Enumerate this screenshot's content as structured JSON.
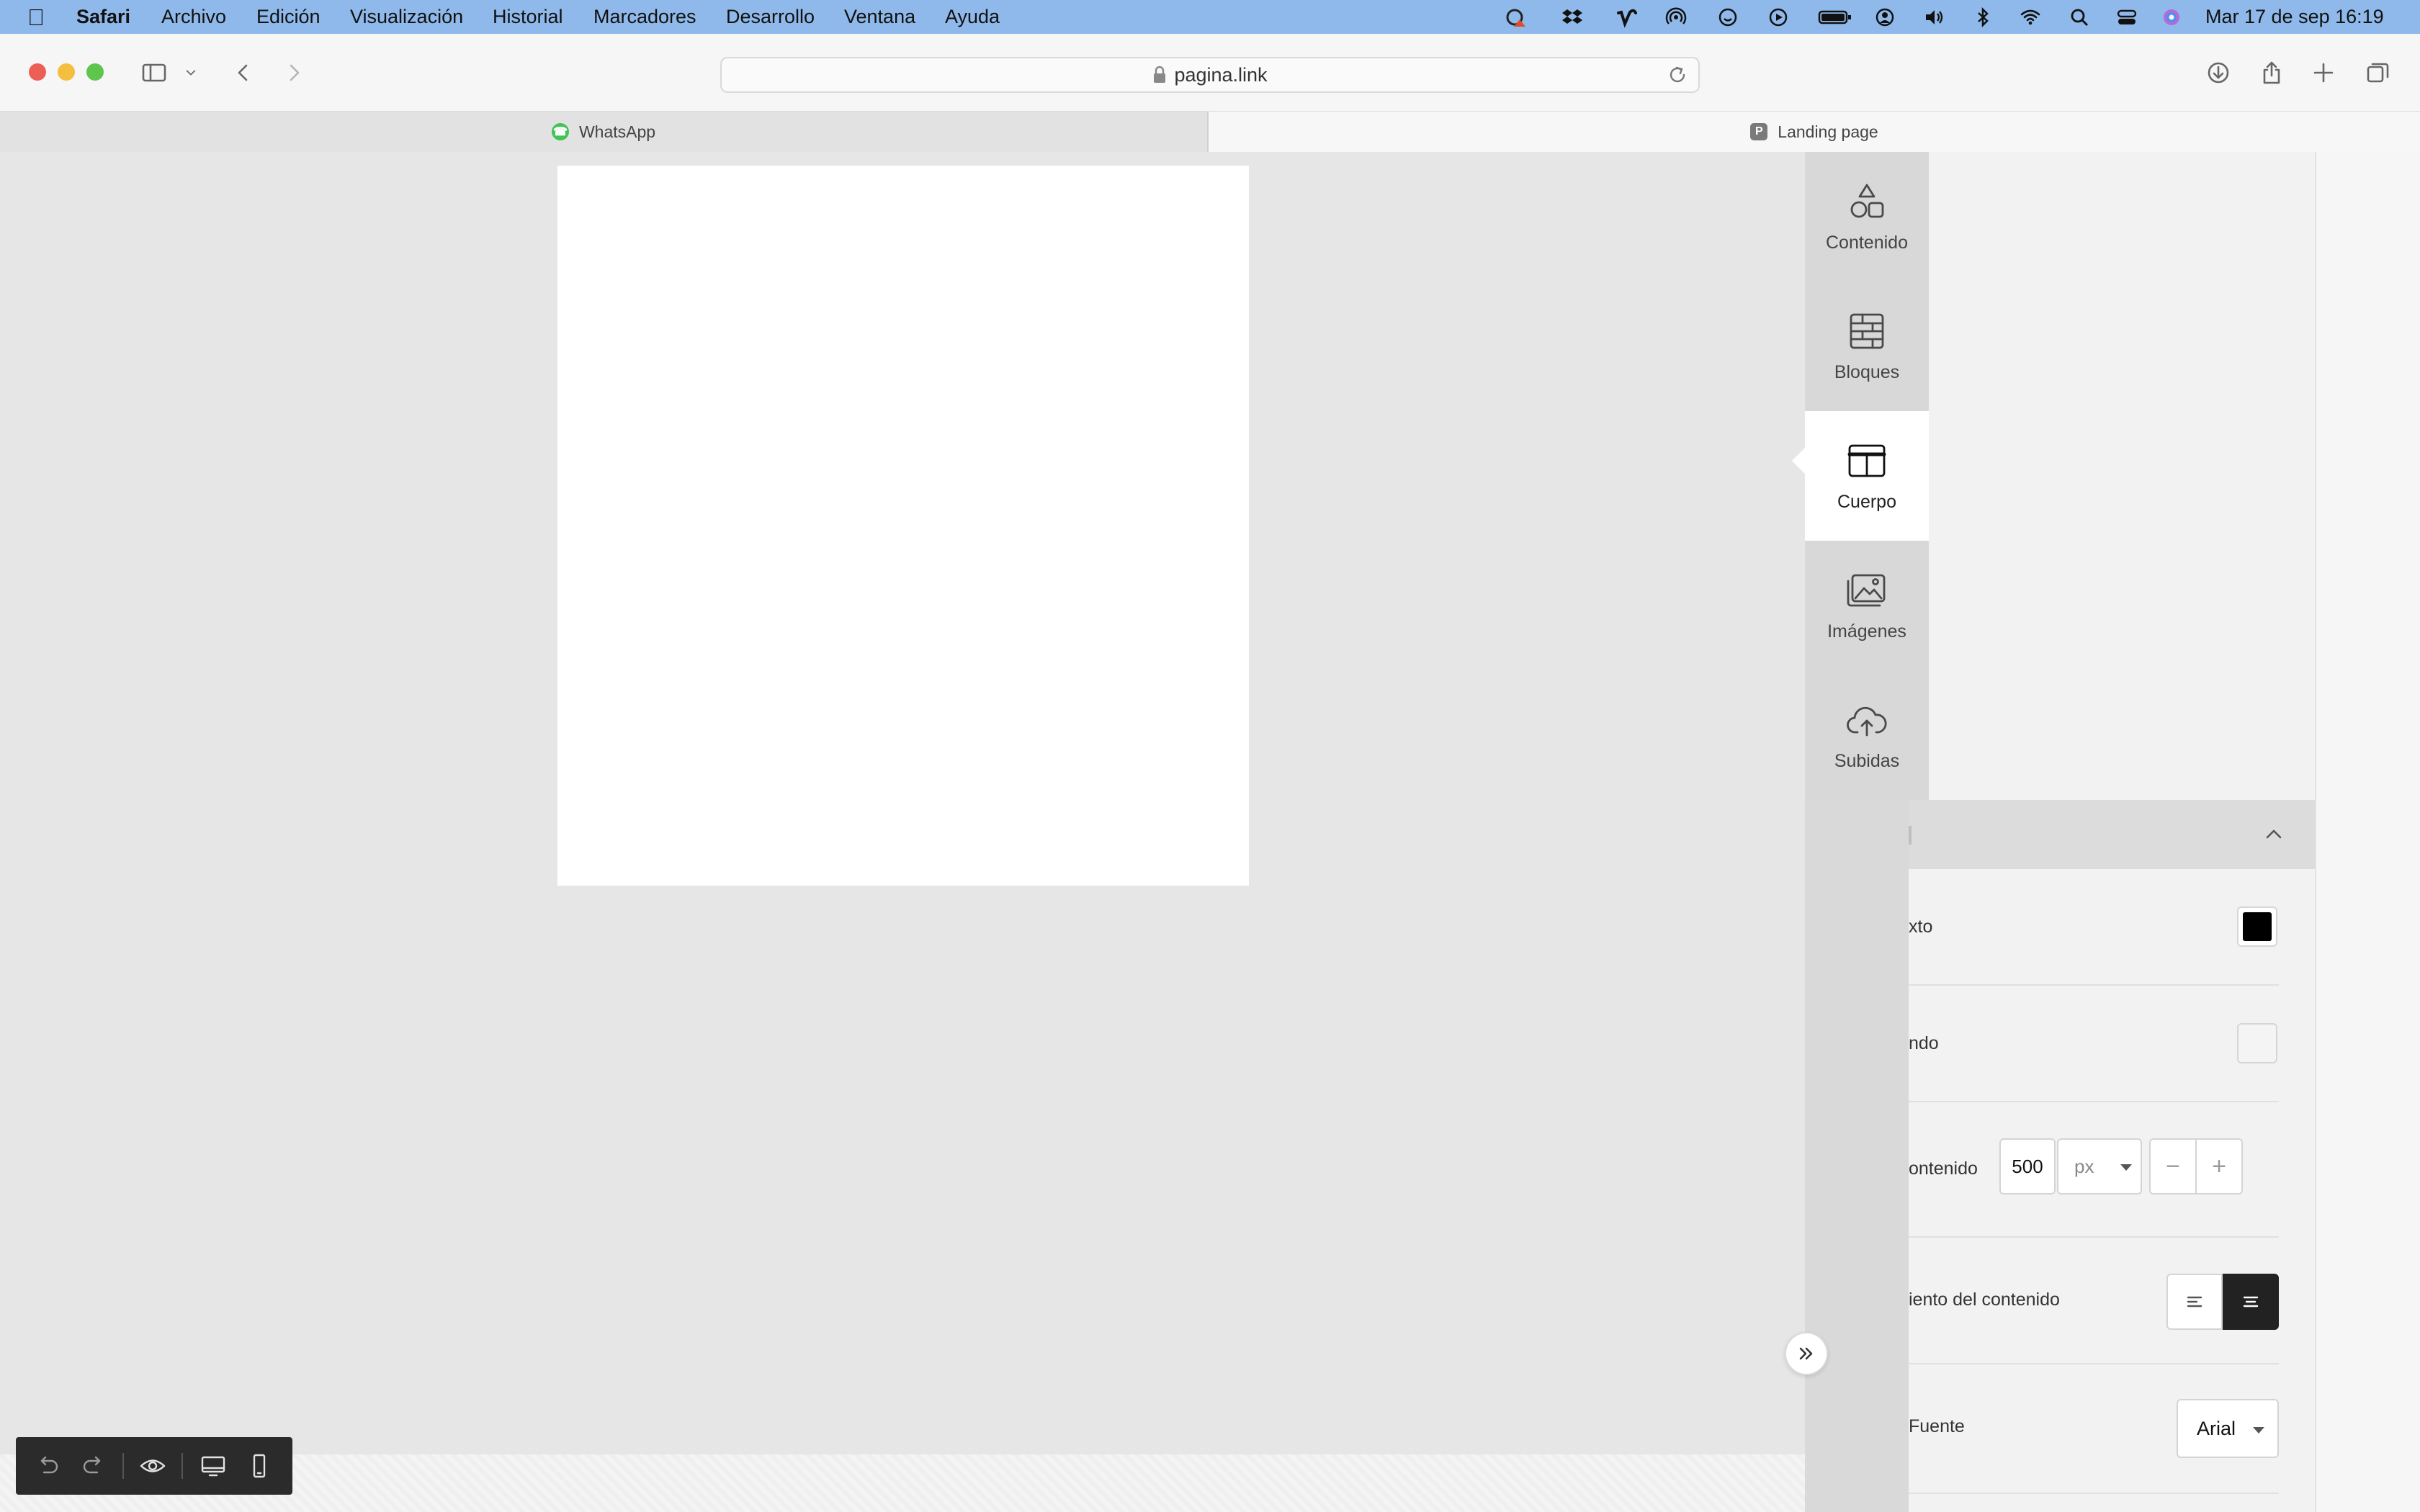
{
  "menubar": {
    "app": "Safari",
    "items": [
      "Archivo",
      "Edición",
      "Visualización",
      "Historial",
      "Marcadores",
      "Desarrollo",
      "Ventana",
      "Ayuda"
    ],
    "datetime": "Mar 17 de sep  16:19",
    "status_icons": [
      "creative-cloud-icon",
      "dropbox-icon",
      "vimeo-icon",
      "airdrop-icon",
      "emoji-icon",
      "play-icon",
      "battery-icon",
      "user-icon",
      "volume-icon",
      "bluetooth-icon",
      "wifi-icon",
      "spotlight-icon",
      "control-center-icon",
      "siri-icon"
    ]
  },
  "toolbar": {
    "url": "pagina.link"
  },
  "tabs": [
    {
      "label": "WhatsApp",
      "favicon": "whatsapp-icon"
    },
    {
      "label": "Landing page",
      "favicon": "P"
    }
  ],
  "sidebar": {
    "tabs": [
      {
        "label": "Contenido",
        "icon": "shapes-icon"
      },
      {
        "label": "Bloques",
        "icon": "blocks-icon"
      },
      {
        "label": "Cuerpo",
        "icon": "layout-icon",
        "active": true
      },
      {
        "label": "Imágenes",
        "icon": "images-icon"
      },
      {
        "label": "Subidas",
        "icon": "upload-cloud-icon"
      }
    ]
  },
  "properties": {
    "text_color_label": "xto",
    "text_color": "#000000",
    "background_label": "ndo",
    "background_color": "#f4f4f4",
    "content_width_label": "ontenido",
    "content_width_value": "500",
    "content_width_unit": "px",
    "decrement": "−",
    "increment": "+",
    "alignment_label": "iento del contenido",
    "alignment_active": "center",
    "font_label": "Fuente",
    "font_value": "Arial"
  }
}
